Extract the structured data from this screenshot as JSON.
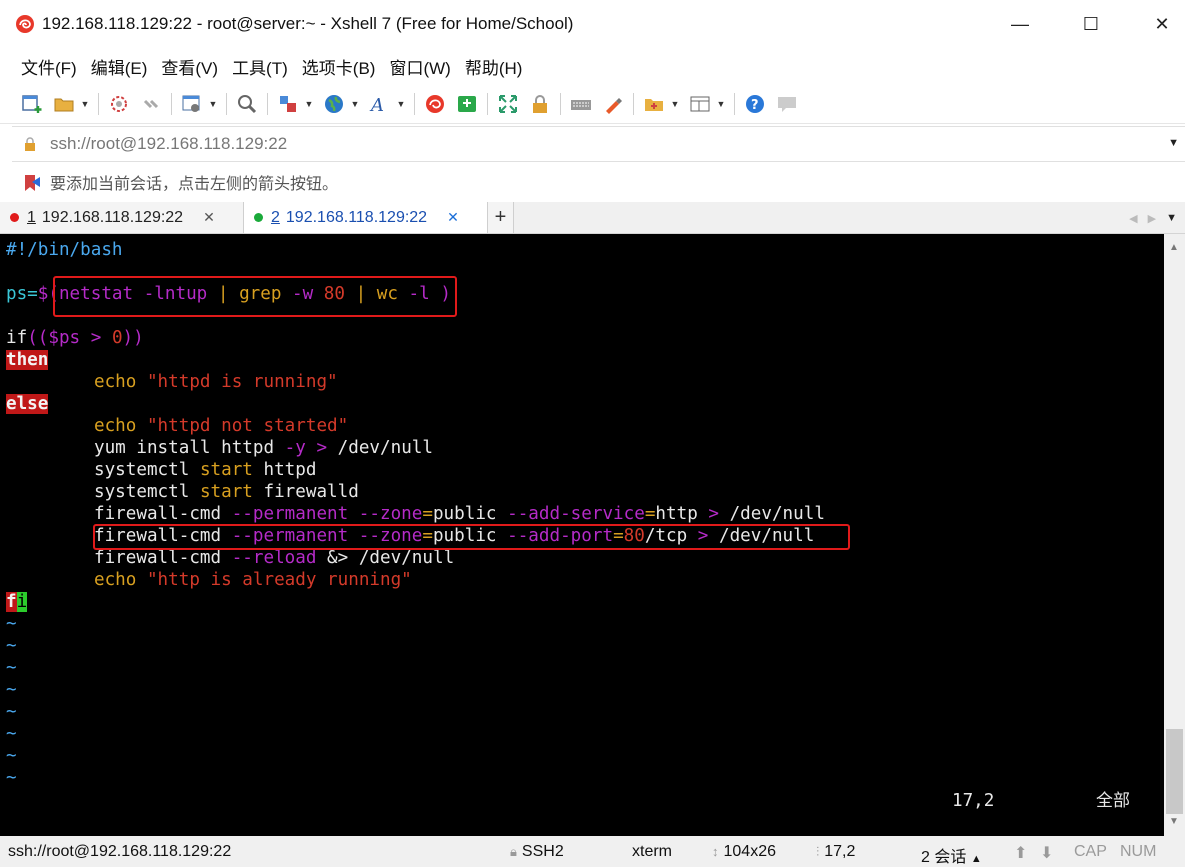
{
  "window": {
    "title": "192.168.118.129:22 - root@server:~ - Xshell 7 (Free for Home/School)",
    "minimize": "—",
    "maximize": "☐",
    "close": "✕"
  },
  "menu": [
    "文件(F)",
    "编辑(E)",
    "查看(V)",
    "工具(T)",
    "选项卡(B)",
    "窗口(W)",
    "帮助(H)"
  ],
  "address": {
    "value": "ssh://root@192.168.118.129:22"
  },
  "hint": {
    "text": "要添加当前会话，点击左侧的箭头按钮。"
  },
  "tabs": [
    {
      "num": "1",
      "label": "192.168.118.129:22",
      "dot_color": "#e01a1a"
    },
    {
      "num": "2",
      "label": "192.168.118.129:22",
      "dot_color": "#1aaa3a"
    }
  ],
  "terminal": {
    "l1": "#!/bin/bash",
    "l3": {
      "a": "ps=",
      "b": "$(",
      "c": "netstat",
      "d": " -lntup",
      "e": " | ",
      "f": "grep",
      "g": " -w",
      "h": " 80",
      "i": " | ",
      "j": "wc",
      "k": " -l",
      "l": " )"
    },
    "l5": {
      "a": "if",
      "b": "((",
      "c": "$ps",
      "d": " > ",
      "e": "0",
      "f": "))"
    },
    "l6": "then",
    "l7": {
      "a": "echo ",
      "b": "\"httpd is running\""
    },
    "l8": "else",
    "l9": {
      "a": "echo ",
      "b": "\"httpd not started\""
    },
    "l10": {
      "a": "yum install httpd ",
      "b": "-y",
      "c": " > ",
      "d": "/dev/null"
    },
    "l11": {
      "a": "systemctl ",
      "b": "start",
      "c": " httpd"
    },
    "l12": {
      "a": "systemctl ",
      "b": "start",
      "c": " firewalld"
    },
    "l13": {
      "a": "firewall-cmd ",
      "b": "--permanent --zone",
      "c": "=",
      "d": "public ",
      "e": "--add-service",
      "f": "=",
      "g": "http",
      "h": " > ",
      "i": "/dev/null"
    },
    "l14": {
      "a": "firewall-cmd ",
      "b": "--permanent --zone",
      "c": "=",
      "d": "public ",
      "e": "--add-port",
      "f": "=",
      "g": "80",
      "h": "/tcp",
      "i": " > ",
      "j": "/dev/null"
    },
    "l15": {
      "a": "firewall-cmd ",
      "b": "--reload",
      "c": " &> ",
      "d": "/dev/null"
    },
    "l16": {
      "a": "echo ",
      "b": "\"http is already running\""
    },
    "l17": {
      "a": "f",
      "b": "i"
    },
    "tilde": "~",
    "ruler": "17,2",
    "viewpos": "全部"
  },
  "status": {
    "connection": "ssh://root@192.168.118.129:22",
    "protocol": "SSH2",
    "term": "xterm",
    "size": "104x26",
    "cursor": "17,2",
    "sessions": "2 会话",
    "cap": "CAP",
    "num": "NUM"
  },
  "colors": {
    "terminal_bg": "#000000",
    "highlight_box": "#e01a1a",
    "keyword_bg": "#c01818",
    "cursor": "#2ccc2c"
  }
}
